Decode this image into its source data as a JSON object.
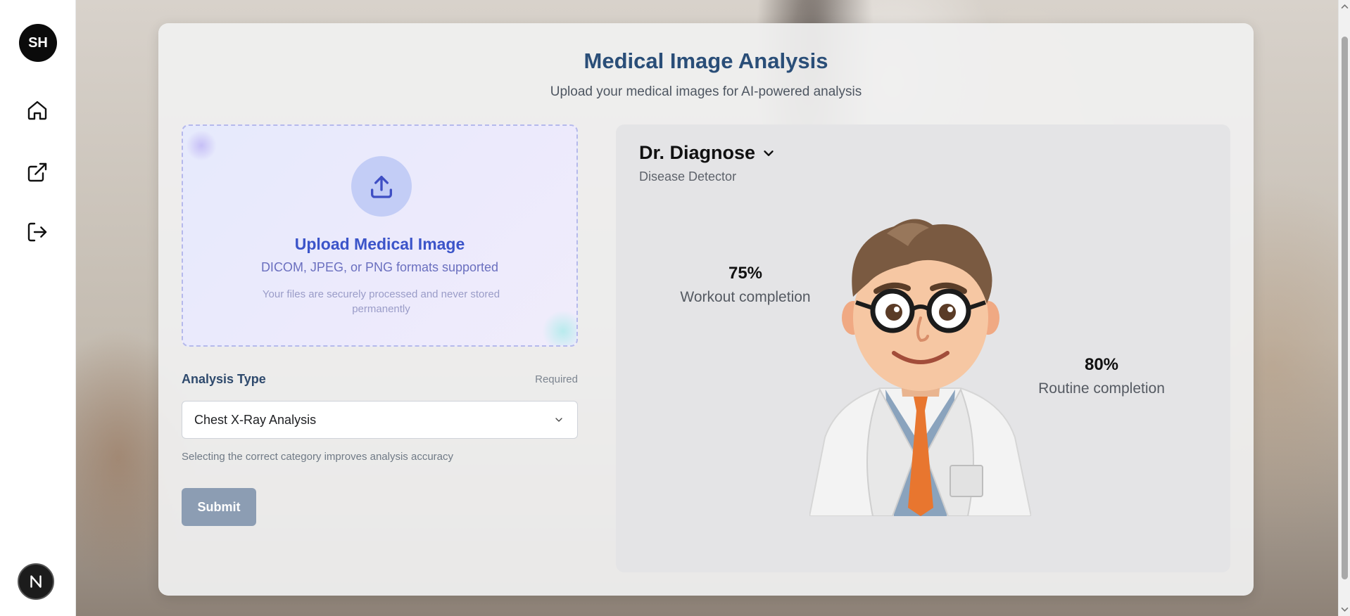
{
  "sidebar": {
    "avatar_initials": "SH",
    "items": [
      {
        "name": "home-icon"
      },
      {
        "name": "external-link-icon"
      },
      {
        "name": "logout-icon"
      }
    ],
    "footer_badge": "N"
  },
  "header": {
    "title": "Medical Image Analysis",
    "subtitle": "Upload your medical images for AI-powered analysis"
  },
  "upload": {
    "icon": "upload-icon",
    "title": "Upload Medical Image",
    "formats": "DICOM, JPEG, or PNG formats supported",
    "note": "Your files are securely processed and never stored permanently"
  },
  "form": {
    "analysis_label": "Analysis Type",
    "required_label": "Required",
    "selected_value": "Chest X-Ray Analysis",
    "hint": "Selecting the correct category improves analysis accuracy",
    "submit_label": "Submit"
  },
  "doctor": {
    "name": "Dr. Diagnose",
    "role": "Disease Detector",
    "stats": [
      {
        "value": "75%",
        "label": "Workout completion"
      },
      {
        "value": "80%",
        "label": "Routine completion"
      }
    ]
  },
  "colors": {
    "title": "#2a4e78",
    "upload_accent": "#3b54c9",
    "submit_bg": "#8c9db3",
    "avatar_bg": "#0b0b0b"
  }
}
